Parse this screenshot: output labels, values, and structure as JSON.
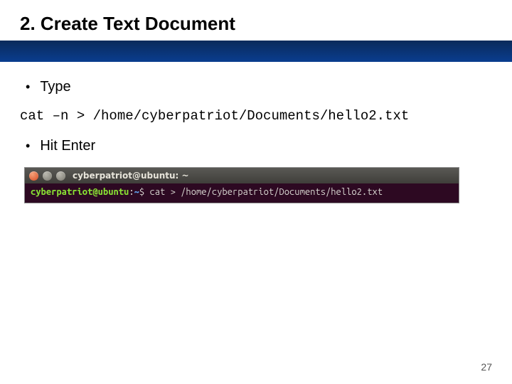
{
  "slide": {
    "title": "2. Create Text Document",
    "bullets": [
      "Type",
      "Hit Enter"
    ],
    "command": "cat –n > /home/cyberpatriot/Documents/hello2.txt",
    "page_number": "27"
  },
  "terminal": {
    "title": "cyberpatriot@ubuntu: ~",
    "prompt_user": "cyberpatriot@ubuntu",
    "prompt_colon": ":",
    "prompt_path": "~",
    "prompt_symbol": "$",
    "command_line": "cat > /home/cyberpatriot/Documents/hello2.txt",
    "icons": {
      "close": "close-icon",
      "minimize": "minimize-icon",
      "maximize": "maximize-icon"
    }
  }
}
